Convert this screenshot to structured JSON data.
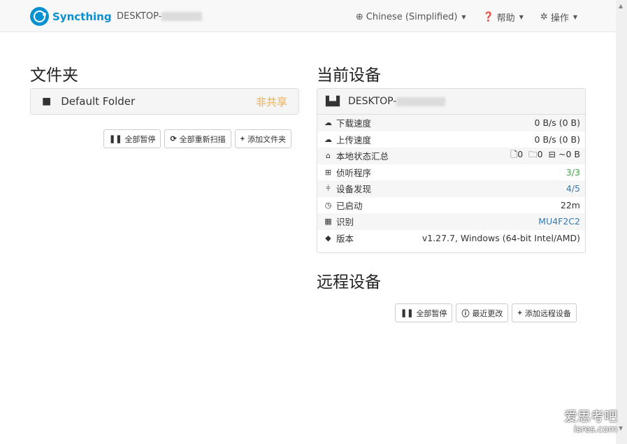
{
  "navbar": {
    "brand": "Syncthing",
    "device_name": "DESKTOP-",
    "language": "Chinese (Simplified)",
    "help": "帮助",
    "actions": "操作"
  },
  "folders": {
    "title": "文件夹",
    "items": [
      {
        "name": "Default Folder",
        "status": "非共享"
      }
    ],
    "buttons": {
      "pause_all": "全部暂停",
      "rescan_all": "全部重新扫描",
      "add_folder": "添加文件夹"
    }
  },
  "this_device": {
    "title": "当前设备",
    "name": "DESKTOP-",
    "rows": [
      {
        "label": "下载速度",
        "value": "0 B/s (0 B)"
      },
      {
        "label": "上传速度",
        "value": "0 B/s (0 B)"
      },
      {
        "label": "本地状态汇总",
        "files": "0",
        "dirs": "0",
        "size": "~0 B"
      },
      {
        "label": "侦听程序",
        "value": "3/3"
      },
      {
        "label": "设备发现",
        "value": "4/5"
      },
      {
        "label": "已启动",
        "value": "22m"
      },
      {
        "label": "识别",
        "value": "MU4F2C2"
      },
      {
        "label": "版本",
        "value": "v1.27.7, Windows (64-bit Intel/AMD)"
      }
    ]
  },
  "remote_devices": {
    "title": "远程设备",
    "buttons": {
      "pause_all": "全部暂停",
      "recent_changes": "最近更改",
      "add_device": "添加远程设备"
    }
  },
  "watermark": {
    "line1": "爱思考吧",
    "line2": "isres.com"
  },
  "colors": {
    "accent": "#0891d1",
    "warning": "#f0ad4e",
    "success": "#3fa63f",
    "link": "#337ab7"
  }
}
